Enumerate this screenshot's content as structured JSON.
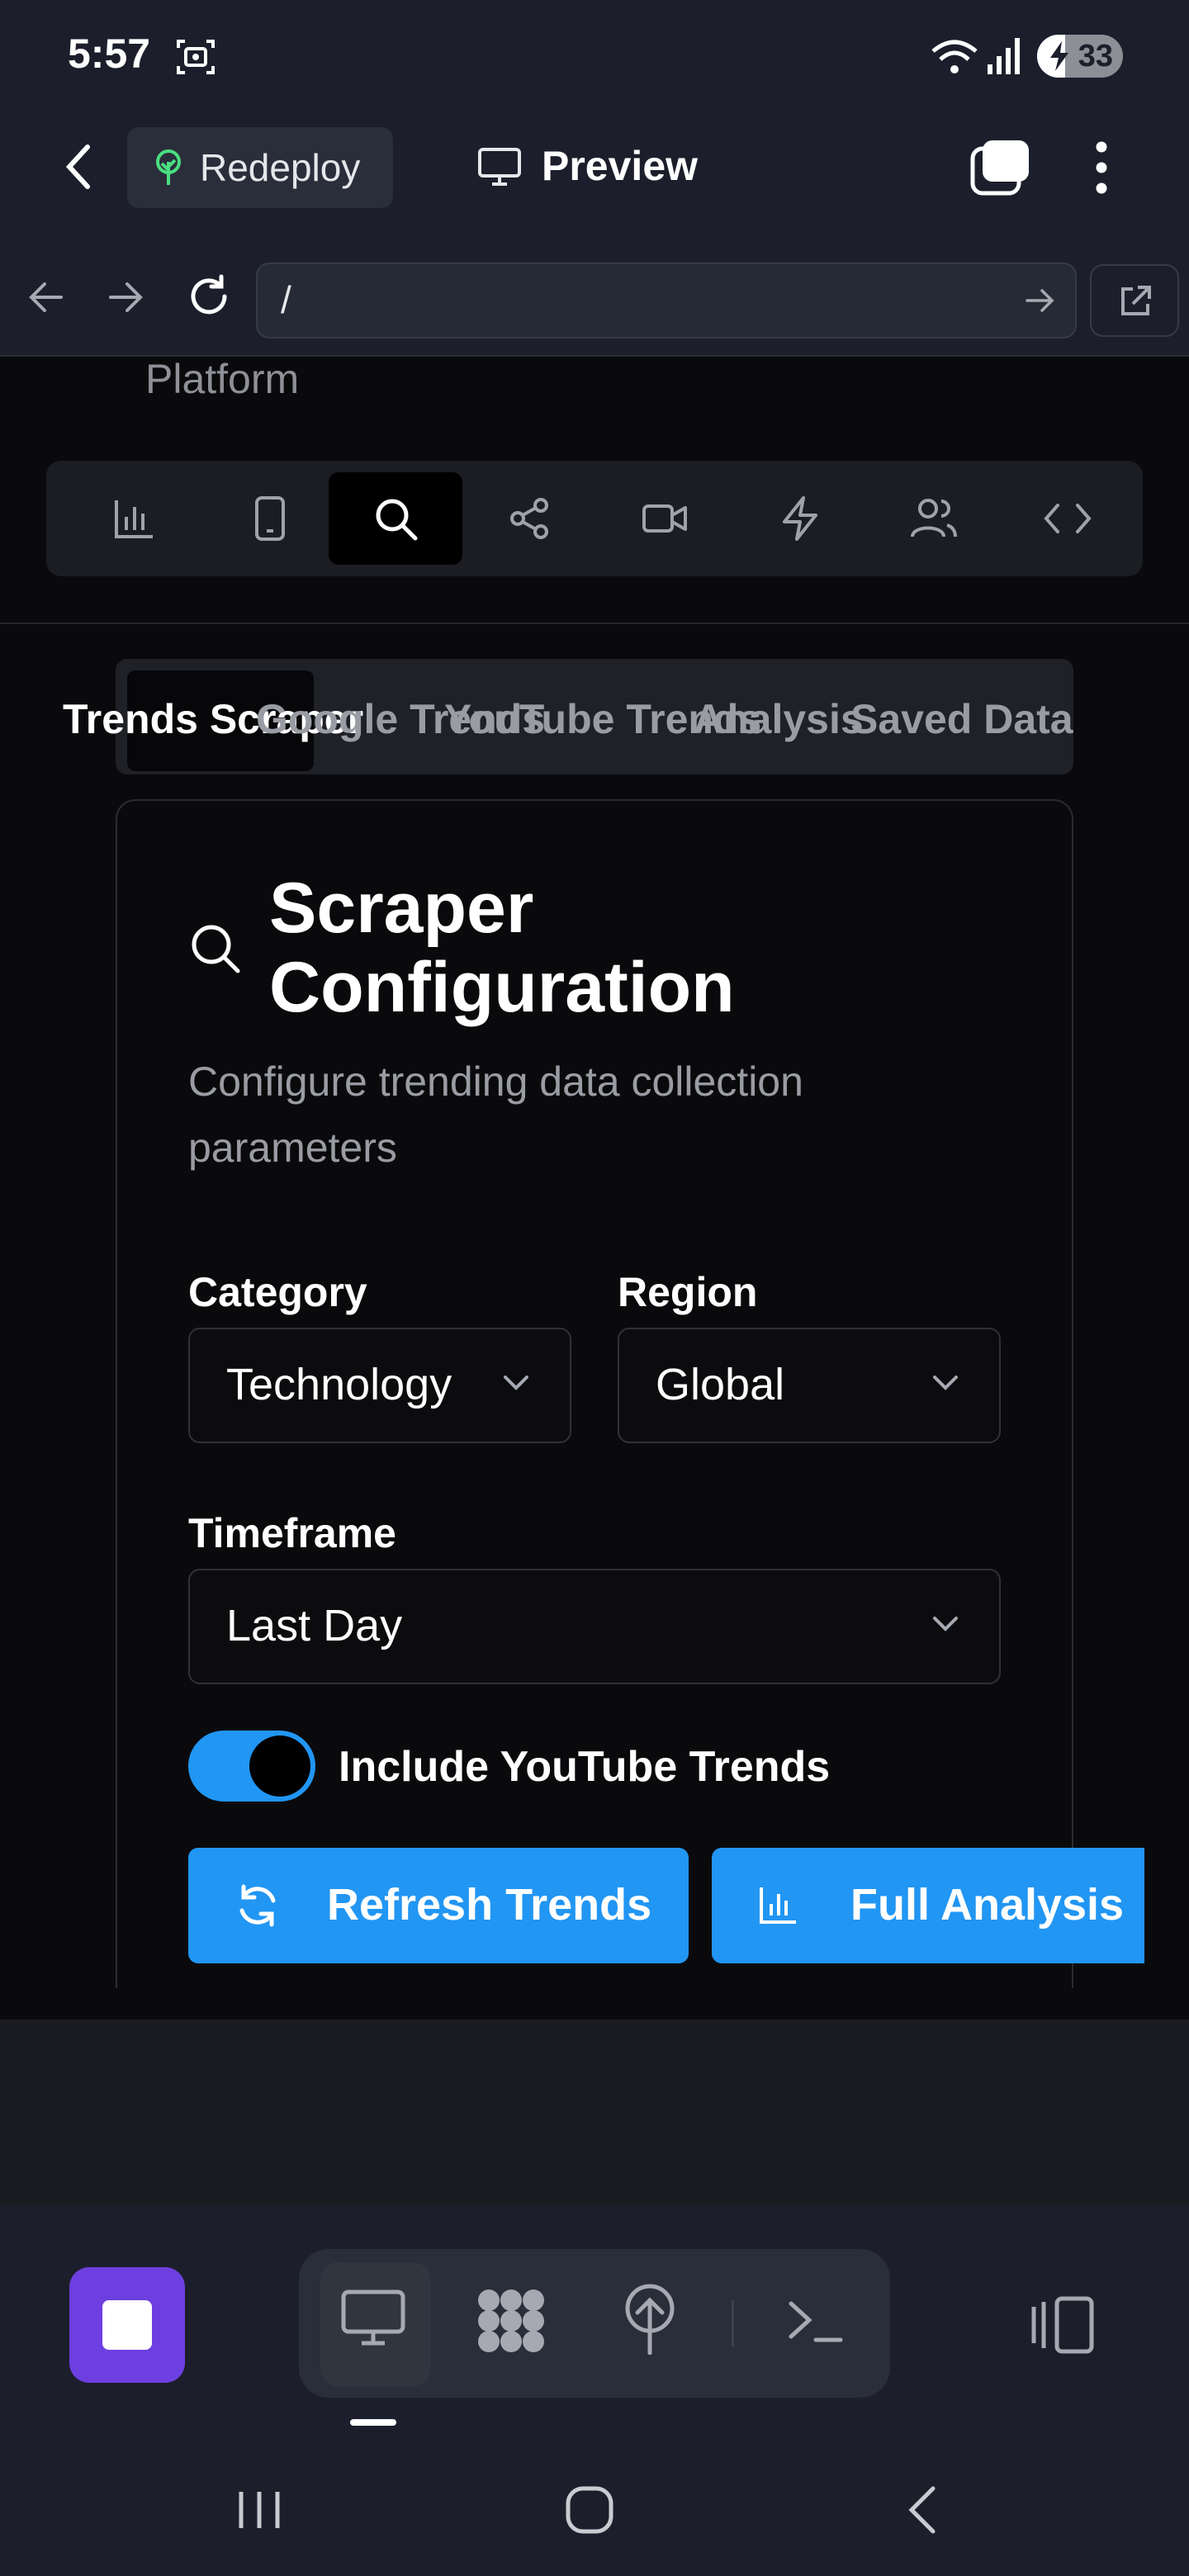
{
  "status_bar": {
    "time": "5:57",
    "battery": "33",
    "battery_level": 0.33
  },
  "header": {
    "redeploy_label": "Redeploy",
    "preview_label": "Preview"
  },
  "browser": {
    "url": "/"
  },
  "page": {
    "partial_heading": "Platform"
  },
  "toolbar": {
    "items": [
      {
        "icon": "bar-chart-icon",
        "active": false
      },
      {
        "icon": "phone-icon",
        "active": false
      },
      {
        "icon": "search-icon",
        "active": true
      },
      {
        "icon": "share-icon",
        "active": false
      },
      {
        "icon": "video-icon",
        "active": false
      },
      {
        "icon": "lightning-icon",
        "active": false
      },
      {
        "icon": "users-icon",
        "active": false
      },
      {
        "icon": "code-icon",
        "active": false
      }
    ]
  },
  "tabs": [
    {
      "label": "Trends Scraper",
      "active": true
    },
    {
      "label": "Google Trends",
      "active": false
    },
    {
      "label": "YouTube Trends",
      "active": false
    },
    {
      "label": "Analysis",
      "active": false
    },
    {
      "label": "Saved Data",
      "active": false
    }
  ],
  "card": {
    "title": "Scraper Configuration",
    "description": "Configure trending data collection parameters",
    "category": {
      "label": "Category",
      "value": "Technology"
    },
    "region": {
      "label": "Region",
      "value": "Global"
    },
    "timeframe": {
      "label": "Timeframe",
      "value": "Last Day"
    },
    "youtube_toggle": {
      "label": "Include YouTube Trends",
      "checked": true
    },
    "refresh_button": "Refresh Trends",
    "analysis_button": "Full Analysis"
  },
  "colors": {
    "accent": "#2196f3",
    "header_bg": "#1c1f2b",
    "page_bg": "#0a0a0c",
    "stop_button": "#6d3fe0"
  }
}
